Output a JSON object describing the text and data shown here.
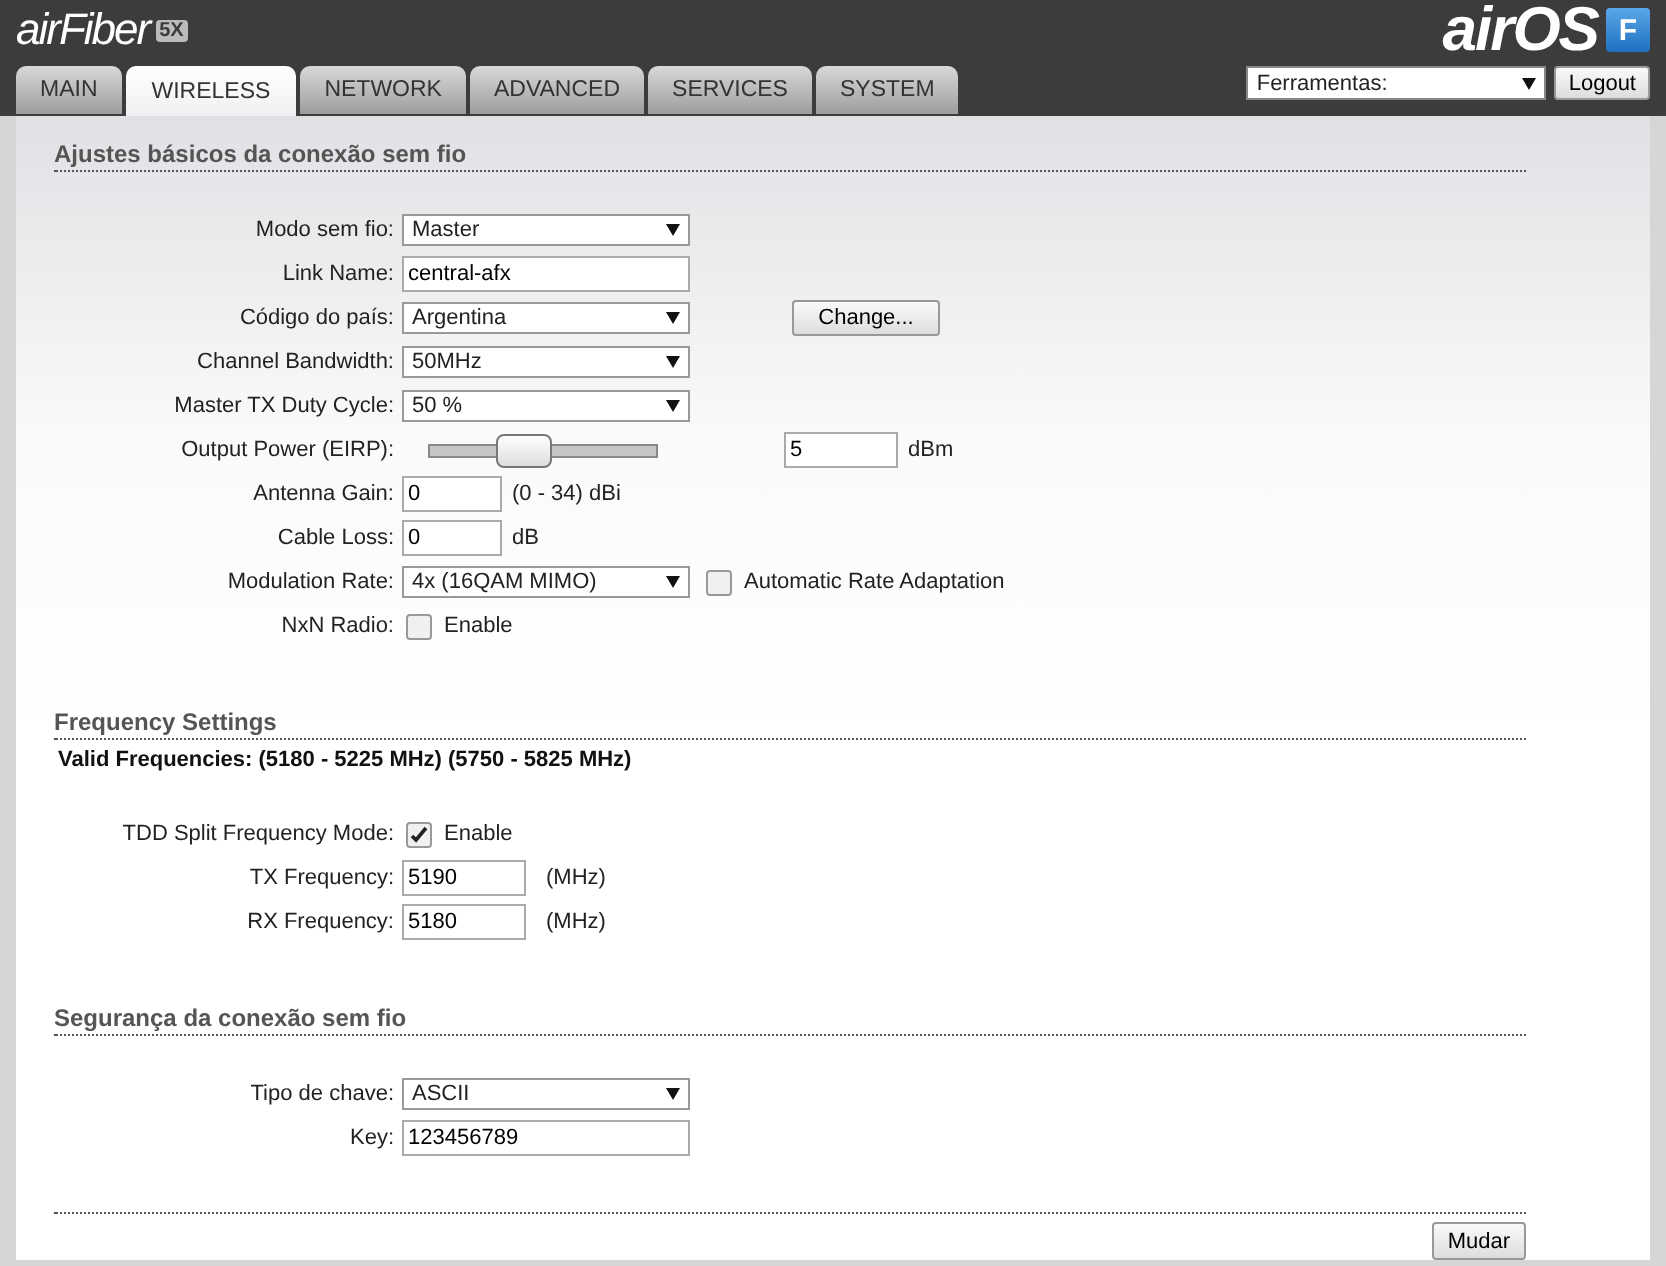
{
  "header": {
    "logo": "airFiber",
    "logo_badge": "5X",
    "brand": "airOS",
    "brand_badge": "F"
  },
  "tabs": [
    {
      "label": "MAIN",
      "selected": false
    },
    {
      "label": "WIRELESS",
      "selected": true
    },
    {
      "label": "NETWORK",
      "selected": false
    },
    {
      "label": "ADVANCED",
      "selected": false
    },
    {
      "label": "SERVICES",
      "selected": false
    },
    {
      "label": "SYSTEM",
      "selected": false
    }
  ],
  "tools": {
    "value": "Ferramentas:",
    "logout": "Logout"
  },
  "sections": [
    {
      "title": "Ajustes básicos da conexão sem fio",
      "rows": [
        {
          "kind": "select",
          "label": "Modo sem fio:",
          "value": "Master"
        },
        {
          "kind": "input",
          "label": "Link Name:",
          "value": "central-afx"
        },
        {
          "kind": "select",
          "label": "Código do país:",
          "value": "Argentina",
          "button": "Change..."
        },
        {
          "kind": "select",
          "label": "Channel Bandwidth:",
          "value": "50MHz"
        },
        {
          "kind": "select",
          "label": "Master TX Duty Cycle:",
          "value": "50 %"
        },
        {
          "kind": "slider",
          "label": "Output Power (EIRP):",
          "level": 0.42,
          "value": "5",
          "unit": "dBm"
        },
        {
          "kind": "short",
          "label": "Antenna Gain:",
          "value": "0",
          "unit": "(0 - 34) dBi"
        },
        {
          "kind": "short",
          "label": "Cable Loss:",
          "value": "0",
          "unit": "dB"
        },
        {
          "kind": "select",
          "label": "Modulation Rate:",
          "value": "4x (16QAM MIMO)",
          "check": {
            "label": "Automatic Rate Adaptation",
            "checked": false
          }
        },
        {
          "kind": "checkbox",
          "label": "NxN Radio:",
          "check": {
            "label": "Enable",
            "checked": false
          }
        }
      ]
    },
    {
      "title": "Frequency Settings",
      "note": "Valid Frequencies: (5180 - 5225 MHz) (5750 - 5825 MHz)",
      "rows": [
        {
          "kind": "checkbox",
          "label": "TDD Split Frequency Mode:",
          "check": {
            "label": "Enable",
            "checked": true
          }
        },
        {
          "kind": "freq",
          "label": "TX Frequency:",
          "value": "5190",
          "unit": "(MHz)"
        },
        {
          "kind": "freq",
          "label": "RX Frequency:",
          "value": "5180",
          "unit": "(MHz)"
        }
      ]
    },
    {
      "title": "Segurança da conexão sem fio",
      "rows": [
        {
          "kind": "select",
          "label": "Tipo de chave:",
          "value": "ASCII"
        },
        {
          "kind": "input",
          "label": "Key:",
          "value": "123456789"
        }
      ]
    }
  ],
  "submit": "Mudar"
}
